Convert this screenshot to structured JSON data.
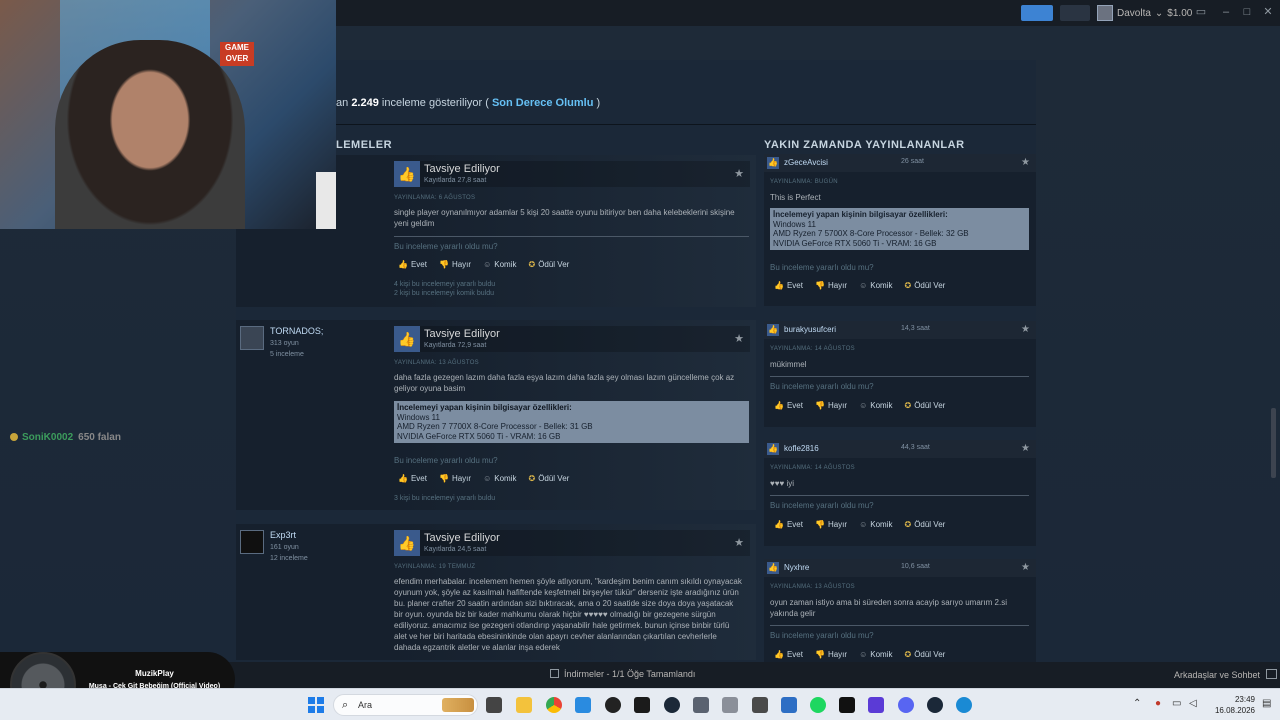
{
  "topbar": {
    "user_name": "Davolta",
    "wallet": "$1.00"
  },
  "summary": {
    "prefix": "an",
    "count": "2.249",
    "middle": "inceleme gösteriliyor (",
    "rating": "Son Derece Olumlu",
    "suffix": ")"
  },
  "sections": {
    "left_title": "LEMELER",
    "right_title": "YAKIN ZAMANDA YAYINLANANLAR"
  },
  "labels": {
    "recommended": "Tavsiye Ediliyor",
    "helpful_q": "Bu inceleme yararlı oldu mu?",
    "yes": "Evet",
    "no": "Hayır",
    "funny": "Komik",
    "award": "Ödül Ver",
    "spec_title": "İncelemeyi yapan kişinin bilgisayar özellikleri:"
  },
  "reviews": [
    {
      "hours": "Kayıtlarda 27,8 saat",
      "date": "YAYINLANMA: 6 AĞUSTOS",
      "text": "single player oynanılmıyor adamlar 5 kişi 20 saatte oyunu bitiriyor ben daha kelebeklerini skişine yeni geldim",
      "stat1": "4 kişi bu incelemeyi yararlı buldu",
      "stat2": "2 kişi bu incelemeyi komik buldu"
    },
    {
      "author": "TORNADOS;",
      "games": "313 oyun",
      "count": "5 inceleme",
      "hours": "Kayıtlarda 72,9 saat",
      "date": "YAYINLANMA: 13 AĞUSTOS",
      "text": "daha fazla gezegen lazım daha fazla eşya lazım daha fazla şey olması lazım güncelleme çok az geliyor oyuna basim",
      "spec_os": "Windows 11",
      "spec_cpu": "AMD Ryzen 7 7700X 8-Core Processor - Bellek: 31 GB",
      "spec_gpu": "NVIDIA GeForce RTX 5060 Ti - VRAM: 16 GB",
      "stat1": "3 kişi bu incelemeyi yararlı buldu"
    },
    {
      "author": "Exp3rt",
      "games": "161 oyun",
      "count": "12 inceleme",
      "hours": "Kayıtlarda 24,5 saat",
      "date": "YAYINLANMA: 19 TEMMUZ",
      "text": "efendim merhabalar. incelemem hemen şöyle atlıyorum, \"kardeşim benim canım sıkıldı oynayacak oyunum yok, şöyle az kasılmalı hafiftende keşfetmeli birşeyler tükür\" derseniz işte aradığınız ürün bu. planer crafter 20 saatin ardından sizi bıktıracak, ama o 20 saatide size doya doya yaşatacak bir oyun. oyunda biz bir kader mahkumu olarak hiçbir ♥♥♥♥♥ olmadığı bir gezegene sürgün ediliyoruz. amacımız ise gezegeni otlandırıp yaşanabilir hale getirmek. bunun içinse binbir türlü alet ve her biri haritada ebesininkinde olan apayrı cevher alanlarından çıkartılan cevherlerle dahada egzantrik aletler ve alanlar inşa ederek"
    }
  ],
  "recent": [
    {
      "name": "zGeceAvcisi",
      "hours": "26 saat",
      "date": "YAYINLANMA: BUGÜN",
      "text": "This is Perfect",
      "spec_os": "Windows 11",
      "spec_cpu": "AMD Ryzen 7 5700X 8-Core Processor - Bellek: 32 GB",
      "spec_gpu": "NVIDIA GeForce RTX 5060 Ti - VRAM: 16 GB"
    },
    {
      "name": "burakyusufceri",
      "hours": "14,3 saat",
      "date": "YAYINLANMA: 14 AĞUSTOS",
      "text": "mükimmel"
    },
    {
      "name": "kofle2816",
      "hours": "44,3 saat",
      "date": "YAYINLANMA: 14 AĞUSTOS",
      "text": "♥♥♥ iyi"
    },
    {
      "name": "Nyxhre",
      "hours": "10,6 saat",
      "date": "YAYINLANMA: 13 AĞUSTOS",
      "text": "oyun zaman istiyo ama bi süreden sonra acayip sarıyo umarım 2.si yakında gelir"
    }
  ],
  "overlay": {
    "cam_sign": "GAME OVER",
    "chat_user": "SoniK0002",
    "chat_msg": "650 falan",
    "music_app": "MuzikPlay",
    "music_song": "Musa - Çek Git Bebeğim (Official Video)"
  },
  "downloads": {
    "text": "İndirmeler - 1/1 Öğe Tamamlandı",
    "friends": "Arkadaşlar ve Sohbet"
  },
  "taskbar": {
    "search_placeholder": "Ara",
    "time": "23:49",
    "date": "16.08.2026"
  },
  "colors": {
    "bg": "#1b2838",
    "accent": "#66c0f4",
    "spec_box": "#7c8da1",
    "award": "#d9b44a"
  }
}
